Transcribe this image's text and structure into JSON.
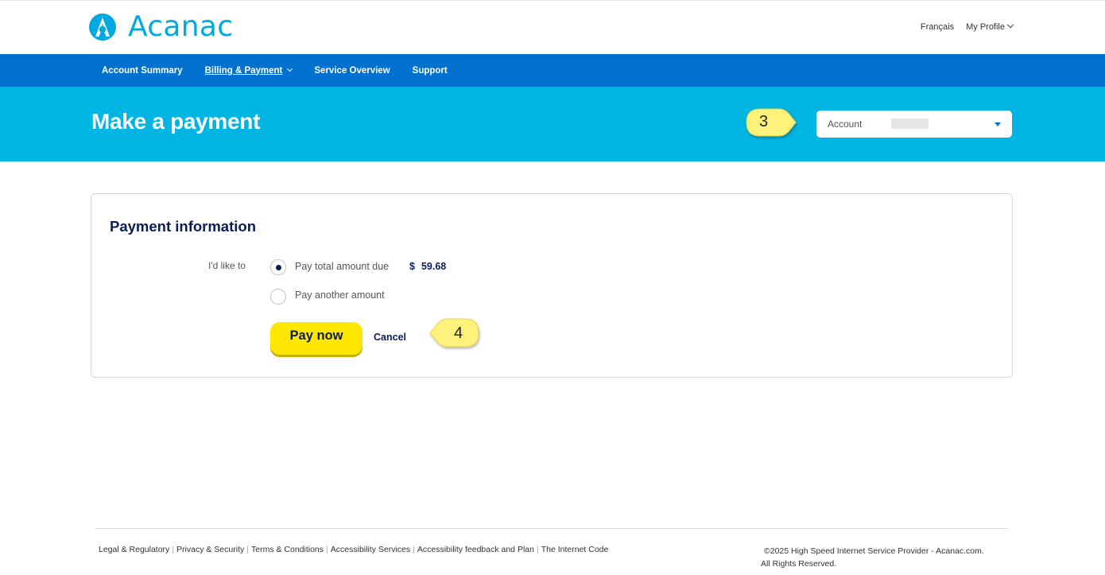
{
  "brand": {
    "name": "Acanac",
    "logo_color": "#00a9e0"
  },
  "top_links": {
    "language": "Français",
    "profile": "My Profile"
  },
  "nav": {
    "items": [
      {
        "label": "Account Summary",
        "active": false
      },
      {
        "label": "Billing & Payment",
        "active": true,
        "has_dropdown": true
      },
      {
        "label": "Service Overview",
        "active": false
      },
      {
        "label": "Support",
        "active": false
      }
    ]
  },
  "hero": {
    "title": "Make a payment",
    "account_select": {
      "label": "Account",
      "value_hidden": true
    }
  },
  "callouts": {
    "step3": "3",
    "step4": "4"
  },
  "payment": {
    "heading": "Payment information",
    "prompt": "I'd like to",
    "options": [
      {
        "label": "Pay total amount due",
        "selected": true
      },
      {
        "label": "Pay another amount",
        "selected": false
      }
    ],
    "amount_currency": "$",
    "amount_value": "59.68",
    "pay_button": "Pay now",
    "cancel": "Cancel"
  },
  "footer": {
    "links": [
      "Legal & Regulatory",
      "Privacy & Security",
      "Terms & Conditions",
      "Accessibility Services",
      "Accessibility feedback and Plan",
      "The Internet Code"
    ],
    "copyright_line1": "©2025 High Speed Internet Service Provider - Acanac.com.",
    "copyright_line2": "All Rights Reserved."
  },
  "colors": {
    "nav_blue": "#0072ce",
    "hero_cyan": "#00b5e2",
    "navy": "#0b1d57",
    "pay_yellow": "#ffe700",
    "callout_yellow": "#fff27a"
  }
}
